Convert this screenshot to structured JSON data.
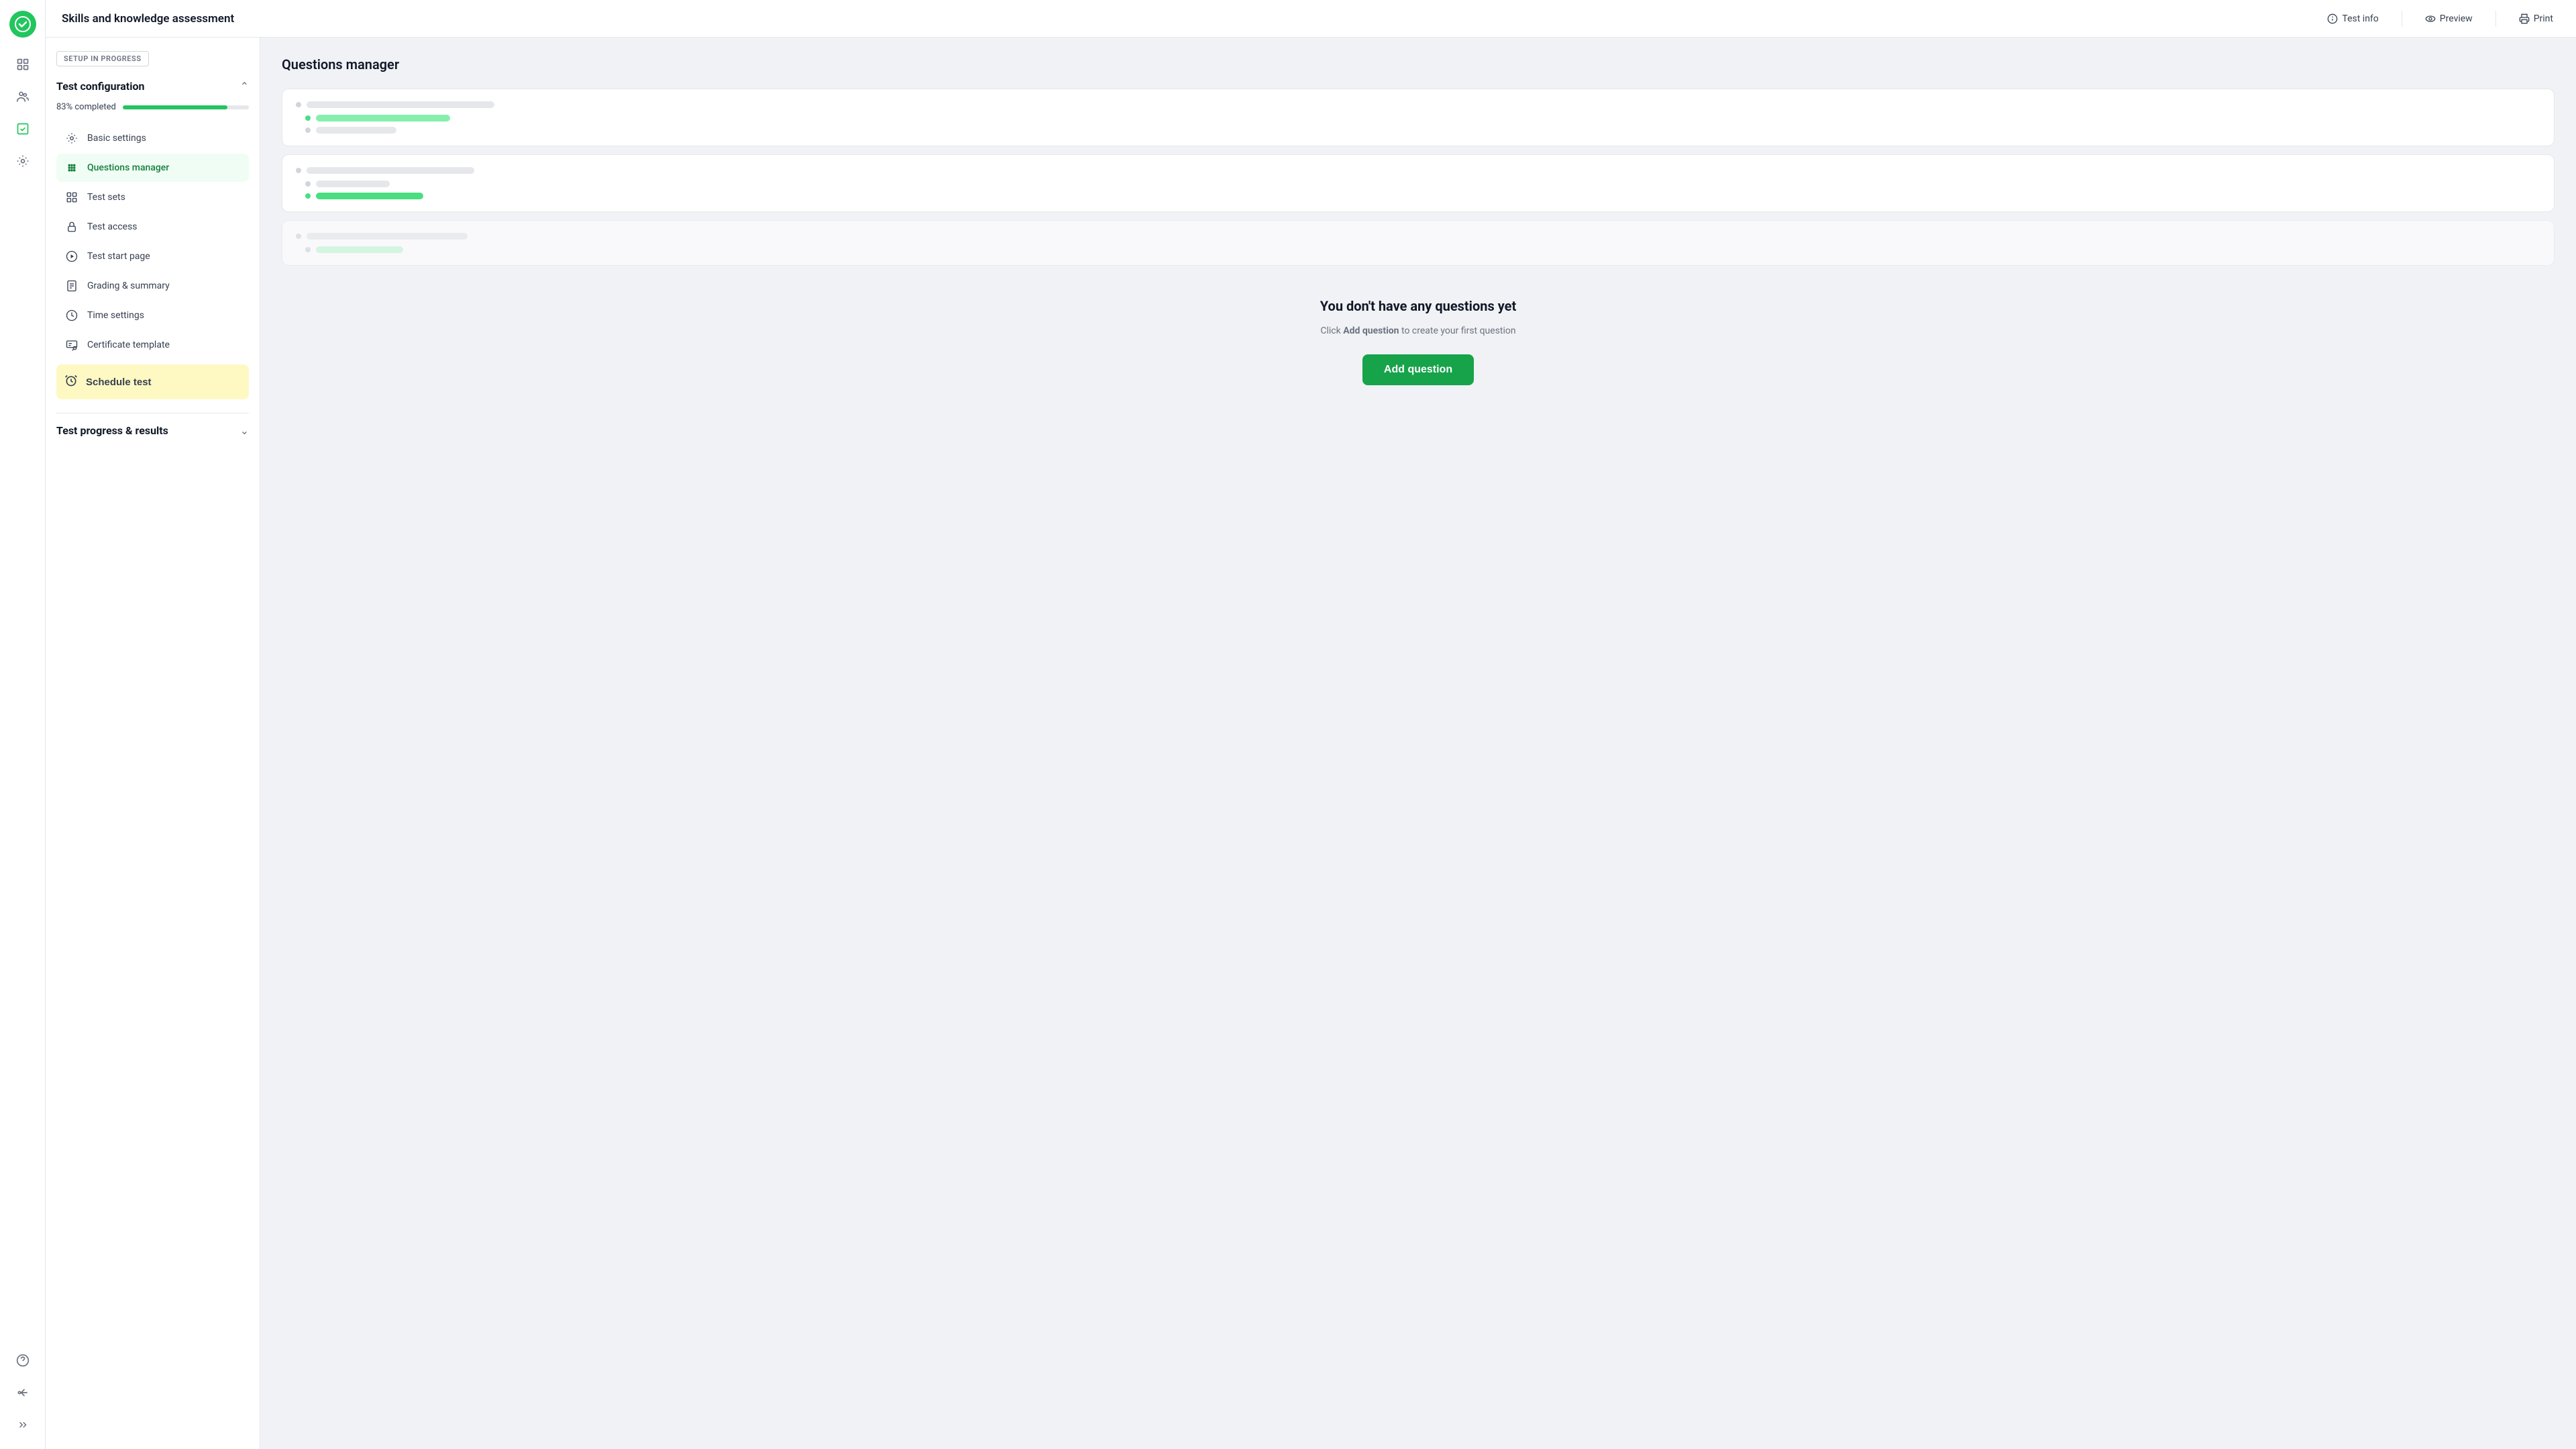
{
  "app": {
    "logo_label": "checkmark"
  },
  "topbar": {
    "title": "Skills and knowledge assessment",
    "actions": [
      {
        "id": "test-info",
        "label": "Test info",
        "icon": "info-circle"
      },
      {
        "id": "preview",
        "label": "Preview",
        "icon": "eye"
      },
      {
        "id": "print",
        "label": "Print",
        "icon": "printer"
      }
    ]
  },
  "sidebar": {
    "setup_badge": "SETUP IN PROGRESS",
    "test_config_title": "Test configuration",
    "progress_label": "83% completed",
    "progress_percent": 83,
    "nav_items": [
      {
        "id": "basic-settings",
        "label": "Basic settings",
        "icon": "gear"
      },
      {
        "id": "questions-manager",
        "label": "Questions manager",
        "icon": "grid-dots",
        "active": true
      },
      {
        "id": "test-sets",
        "label": "Test sets",
        "icon": "squares"
      },
      {
        "id": "test-access",
        "label": "Test access",
        "icon": "lock"
      },
      {
        "id": "test-start-page",
        "label": "Test start page",
        "icon": "circle-play"
      },
      {
        "id": "grading-summary",
        "label": "Grading & summary",
        "icon": "document-list"
      },
      {
        "id": "time-settings",
        "label": "Time settings",
        "icon": "clock"
      },
      {
        "id": "certificate-template",
        "label": "Certificate template",
        "icon": "certificate"
      }
    ],
    "schedule_test_label": "Schedule test",
    "schedule_icon": "clock-alarm",
    "test_progress_title": "Test progress & results"
  },
  "main": {
    "title": "Questions manager",
    "empty_state": {
      "heading": "You don't have any questions yet",
      "description_prefix": "Click ",
      "description_bold": "Add question",
      "description_suffix": " to create your first question",
      "add_button_label": "Add question"
    }
  }
}
